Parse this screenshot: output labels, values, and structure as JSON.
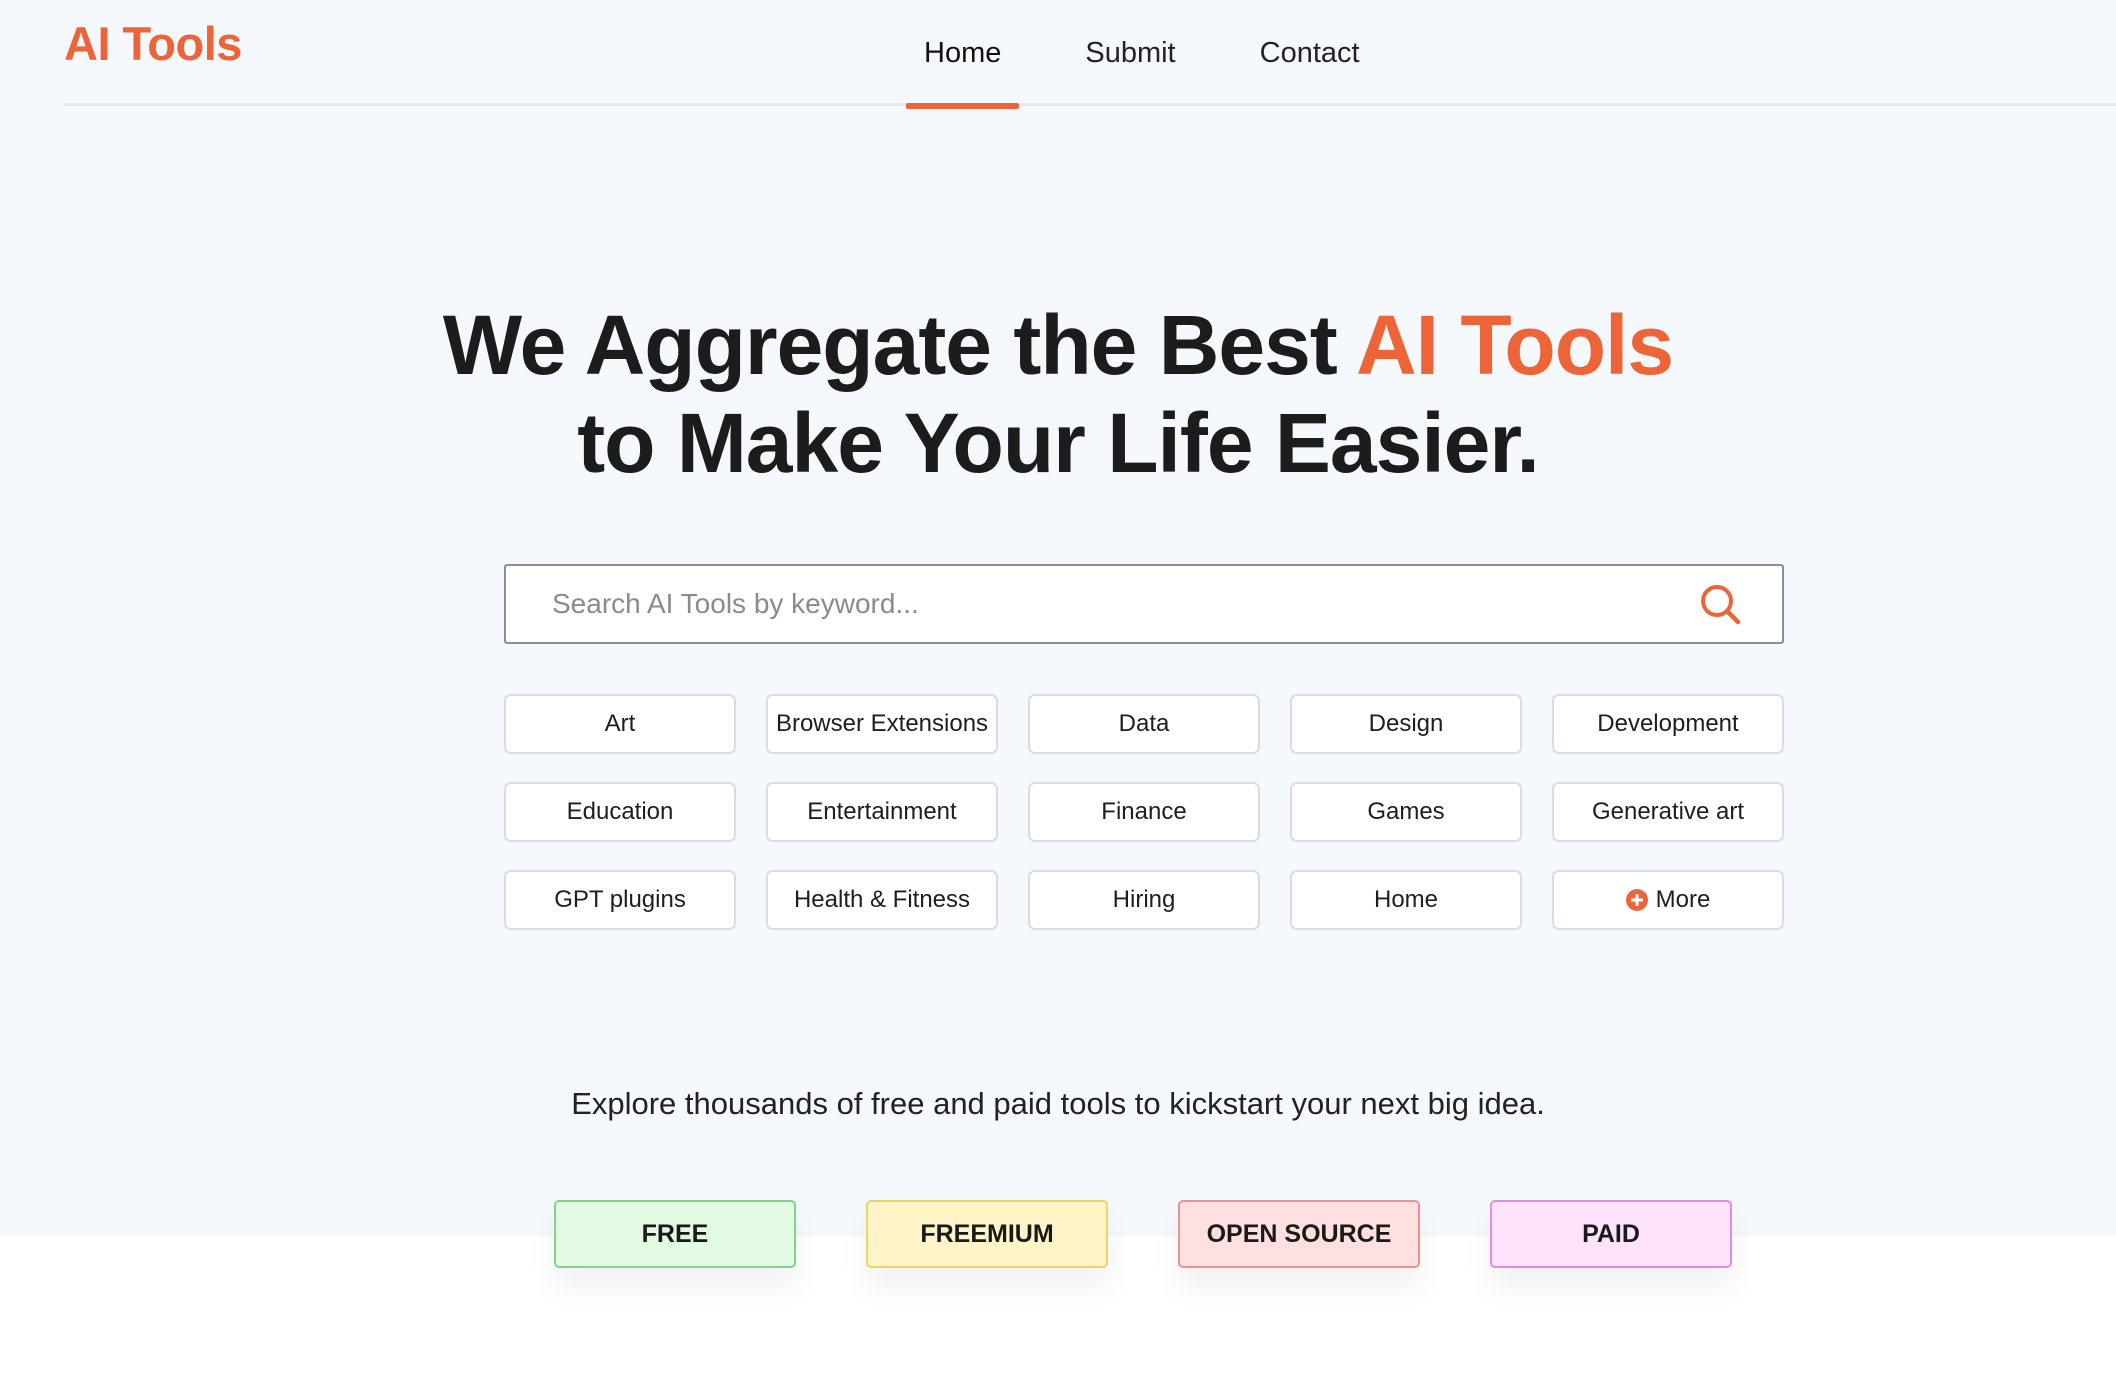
{
  "header": {
    "logo": "AI Tools",
    "nav": [
      {
        "label": "Home",
        "active": true
      },
      {
        "label": "Submit",
        "active": false
      },
      {
        "label": "Contact",
        "active": false
      }
    ]
  },
  "hero": {
    "headline_part1": "We Aggregate the Best ",
    "headline_accent": "AI Tools",
    "headline_part2": "to Make Your Life Easier.",
    "search_placeholder": "Search AI Tools by keyword...",
    "search_icon": "search-icon"
  },
  "categories": [
    "Art",
    "Browser Extensions",
    "Data",
    "Design",
    "Development",
    "Education",
    "Entertainment",
    "Finance",
    "Games",
    "Generative art",
    "GPT plugins",
    "Health & Fitness",
    "Hiring",
    "Home"
  ],
  "more_label": "More",
  "tagline": "Explore thousands of free and paid tools to kickstart your next big idea.",
  "pricing": [
    "FREE",
    "FREEMIUM",
    "OPEN SOURCE",
    "PAID"
  ],
  "colors": {
    "accent": "#ec6438",
    "free": "#e2f9e2",
    "freemium": "#fff4c7",
    "open_source": "#fde0df",
    "paid": "#fde3fb"
  }
}
